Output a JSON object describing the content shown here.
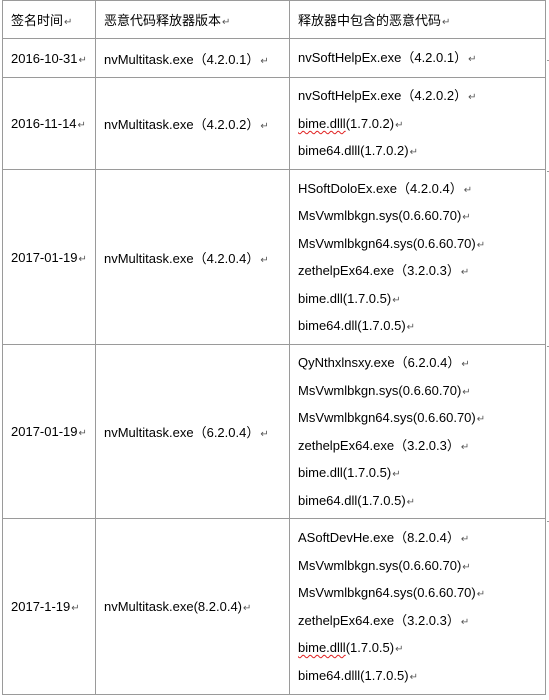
{
  "headers": [
    "签名时间",
    "恶意代码释放器版本",
    "释放器中包含的恶意代码"
  ],
  "para_mark": "↵",
  "rows": [
    {
      "date": "2016-10-31",
      "dropper": "nvMultitask.exe（4.2.0.1）",
      "files": [
        {
          "name": "nvSoftHelpEx.exe（4.2.0.1）"
        }
      ]
    },
    {
      "date": "2016-11-14",
      "dropper": "nvMultitask.exe（4.2.0.2）",
      "files": [
        {
          "name": "nvSoftHelpEx.exe（4.2.0.2）"
        },
        {
          "name_pre": "",
          "name_squiggle": "bime.dlll",
          "name_post": "(1.7.0.2)"
        },
        {
          "name": "bime64.dlll(1.7.0.2)"
        }
      ]
    },
    {
      "date": "2017-01-19",
      "dropper": "nvMultitask.exe（4.2.0.4）",
      "files": [
        {
          "name": "HSoftDoloEx.exe（4.2.0.4）"
        },
        {
          "name": "MsVwmlbkgn.sys(0.6.60.70)"
        },
        {
          "name": "MsVwmlbkgn64.sys(0.6.60.70)"
        },
        {
          "name": "zethelpEx64.exe（3.2.0.3）"
        },
        {
          "name": "bime.dll(1.7.0.5)"
        },
        {
          "name": "bime64.dll(1.7.0.5)"
        }
      ]
    },
    {
      "date": "2017-01-19",
      "dropper": "nvMultitask.exe（6.2.0.4）",
      "files": [
        {
          "name": "QyNthxlnsxy.exe（6.2.0.4）"
        },
        {
          "name": "MsVwmlbkgn.sys(0.6.60.70)"
        },
        {
          "name": "MsVwmlbkgn64.sys(0.6.60.70)"
        },
        {
          "name": "zethelpEx64.exe（3.2.0.3）"
        },
        {
          "name": "bime.dll(1.7.0.5)"
        },
        {
          "name": "bime64.dll(1.7.0.5)"
        }
      ]
    },
    {
      "date": "2017-1-19",
      "dropper": "nvMultitask.exe(8.2.0.4)",
      "files": [
        {
          "name": "ASoftDevHe.exe（8.2.0.4）"
        },
        {
          "name": "MsVwmlbkgn.sys(0.6.60.70)"
        },
        {
          "name": "MsVwmlbkgn64.sys(0.6.60.70)"
        },
        {
          "name": "zethelpEx64.exe（3.2.0.3）"
        },
        {
          "name_pre": "",
          "name_squiggle": "bime.dlll",
          "name_post": "(1.7.0.5)"
        },
        {
          "name": "bime64.dlll(1.7.0.5)"
        }
      ]
    }
  ]
}
